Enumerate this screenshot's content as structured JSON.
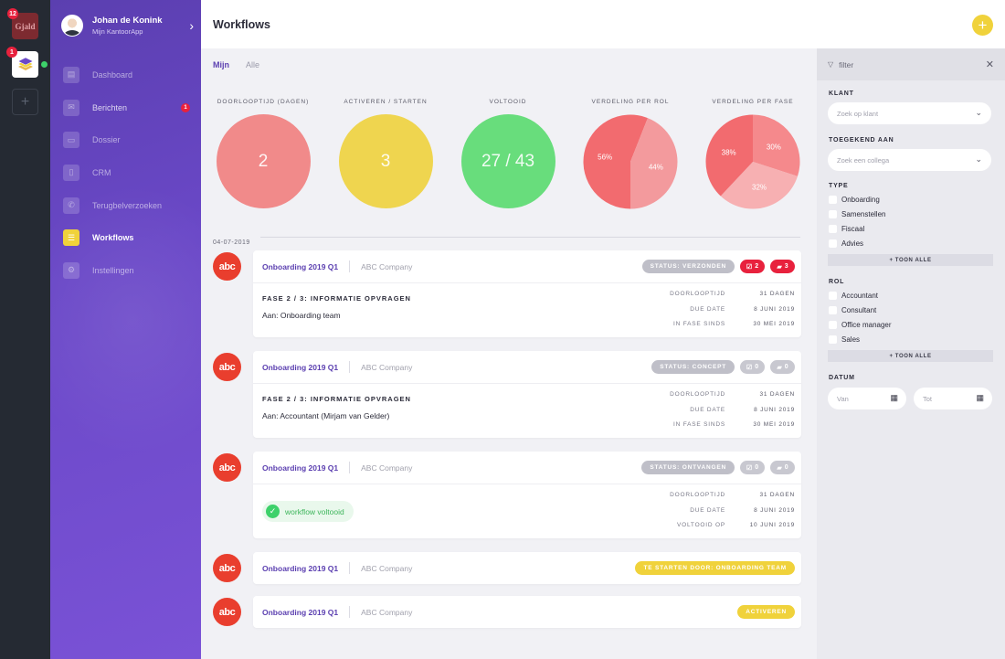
{
  "rail": {
    "apps": [
      {
        "name": "Gjald",
        "badge": "12"
      },
      {
        "name": "KantoorApp",
        "badge": "1",
        "online": true
      }
    ],
    "add_label": "+"
  },
  "sidebar": {
    "profile": {
      "name": "Johan de Konink",
      "subtitle": "Mijn KantoorApp"
    },
    "items": [
      {
        "label": "Dashboard",
        "icon": "dashboard-icon"
      },
      {
        "label": "Berichten",
        "icon": "messages-icon",
        "badge": "1"
      },
      {
        "label": "Dossier",
        "icon": "folder-icon"
      },
      {
        "label": "CRM",
        "icon": "contacts-icon"
      },
      {
        "label": "Terugbelverzoeken",
        "icon": "phone-icon"
      },
      {
        "label": "Workflows",
        "icon": "list-icon",
        "active": true
      },
      {
        "label": "Instellingen",
        "icon": "gear-icon"
      }
    ]
  },
  "header": {
    "title": "Workflows",
    "add_label": "+"
  },
  "tabs": [
    {
      "label": "Mijn",
      "active": true
    },
    {
      "label": "Alle",
      "active": false
    }
  ],
  "stats": [
    {
      "label": "DOORLOOPTIJD (DAGEN)",
      "value": "2",
      "color": "#f18a8a"
    },
    {
      "label": "ACTIVEREN / STARTEN",
      "value": "3",
      "color": "#efd54f"
    },
    {
      "label": "VOLTOOID",
      "value": "27 / 43",
      "color": "#68dd7c"
    }
  ],
  "chart_data": [
    {
      "type": "pie",
      "title": "VERDELING PER ROL",
      "categories": [
        "56%",
        "44%"
      ],
      "values": [
        56,
        44
      ],
      "colors": [
        "#f26b6f",
        "#f39a9d"
      ]
    },
    {
      "type": "pie",
      "title": "VERDELING PER FASE",
      "categories": [
        "30%",
        "32%",
        "38%"
      ],
      "values": [
        30,
        32,
        38
      ],
      "colors": [
        "#f5898c",
        "#f7b0b2",
        "#f26b6f"
      ]
    }
  ],
  "date_group": "04-07-2019",
  "workflows": [
    {
      "logo": "abc",
      "title": "Onboarding 2019 Q1",
      "company": "ABC Company",
      "status": "STATUS: VERZONDEN",
      "tasks": "2",
      "messages": "3",
      "phase": "FASE 2 / 3: INFORMATIE OPVRAGEN",
      "assignee": "Aan: Onboarding team",
      "meta": [
        {
          "k": "DOORLOOPTIJD",
          "v": "31 DAGEN"
        },
        {
          "k": "DUE DATE",
          "v": "8 JUNI 2019"
        },
        {
          "k": "IN FASE SINDS",
          "v": "30 MEI 2019"
        }
      ]
    },
    {
      "logo": "abc",
      "title": "Onboarding 2019 Q1",
      "company": "ABC Company",
      "status": "STATUS: CONCEPT",
      "tasks": "0",
      "messages": "0",
      "phase": "FASE 2 / 3: INFORMATIE OPVRAGEN",
      "assignee": "Aan: Accountant (Mirjam van Gelder)",
      "meta": [
        {
          "k": "DOORLOOPTIJD",
          "v": "31 DAGEN"
        },
        {
          "k": "DUE DATE",
          "v": "8 JUNI 2019"
        },
        {
          "k": "IN FASE SINDS",
          "v": "30 MEI 2019"
        }
      ]
    },
    {
      "logo": "abc",
      "title": "Onboarding 2019 Q1",
      "company": "ABC Company",
      "status": "STATUS: ONTVANGEN",
      "tasks": "0",
      "messages": "0",
      "done_label": "workflow voltooid",
      "meta": [
        {
          "k": "DOORLOOPTIJD",
          "v": "31 DAGEN"
        },
        {
          "k": "DUE DATE",
          "v": "8 JUNI 2019"
        },
        {
          "k": "VOLTOOID OP",
          "v": "10 JUNI 2019"
        }
      ]
    },
    {
      "logo": "abc",
      "title": "Onboarding 2019 Q1",
      "company": "ABC Company",
      "action": "TE STARTEN DOOR: ONBOARDING TEAM"
    },
    {
      "logo": "abc",
      "title": "Onboarding 2019 Q1",
      "company": "ABC Company",
      "action": "ACTIVEREN"
    }
  ],
  "filter": {
    "title": "filter",
    "klant_label": "KLANT",
    "klant_placeholder": "Zoek op klant",
    "toegekend_label": "TOEGEKEND AAN",
    "toegekend_placeholder": "Zoek een collega",
    "type_label": "TYPE",
    "types": [
      "Onboarding",
      "Samenstellen",
      "Fiscaal",
      "Advies"
    ],
    "rol_label": "ROL",
    "rollen": [
      "Accountant",
      "Consultant",
      "Office manager",
      "Sales"
    ],
    "show_all": "+ TOON ALLE",
    "datum_label": "DATUM",
    "van": "Van",
    "tot": "Tot"
  }
}
